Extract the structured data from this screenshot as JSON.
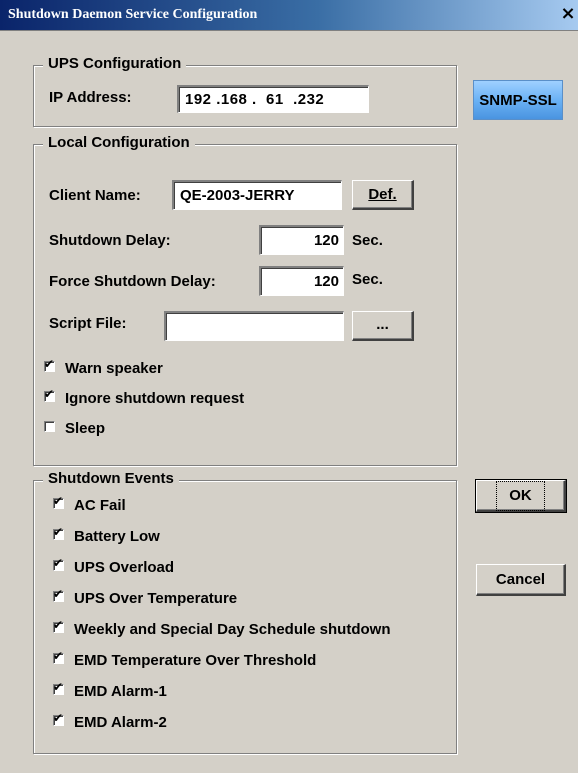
{
  "window": {
    "title": "Shutdown Daemon Service Configuration",
    "close_glyph": "×"
  },
  "ups": {
    "legend": "UPS Configuration",
    "ip_label": "IP Address:",
    "ip_value": "192 .168 .  61  .232"
  },
  "snmp_button": "SNMP-SSL",
  "local": {
    "legend": "Local Configuration",
    "client_label": "Client Name:",
    "client_value": "QE-2003-JERRY",
    "def_button": "Def.",
    "shutdown_delay_label": "Shutdown Delay:",
    "shutdown_delay_value": "120",
    "shutdown_delay_unit": "Sec.",
    "force_delay_label": "Force Shutdown Delay:",
    "force_delay_value": "120",
    "force_delay_unit": "Sec.",
    "script_label": "Script File:",
    "script_value": "",
    "browse_button": "...",
    "checkboxes": [
      {
        "label": "Warn speaker",
        "checked": true
      },
      {
        "label": "Ignore shutdown request",
        "checked": true
      },
      {
        "label": "Sleep",
        "checked": false
      }
    ]
  },
  "events": {
    "legend": "Shutdown Events",
    "items": [
      {
        "label": "AC Fail",
        "checked": true
      },
      {
        "label": "Battery Low",
        "checked": true
      },
      {
        "label": "UPS Overload",
        "checked": true
      },
      {
        "label": "UPS Over Temperature",
        "checked": true
      },
      {
        "label": "Weekly and Special Day Schedule shutdown",
        "checked": true
      },
      {
        "label": "EMD Temperature Over Threshold",
        "checked": true
      },
      {
        "label": "EMD Alarm-1",
        "checked": true
      },
      {
        "label": "EMD Alarm-2",
        "checked": true
      }
    ]
  },
  "buttons": {
    "ok": "OK",
    "cancel": "Cancel"
  },
  "check_glyph": "✔"
}
